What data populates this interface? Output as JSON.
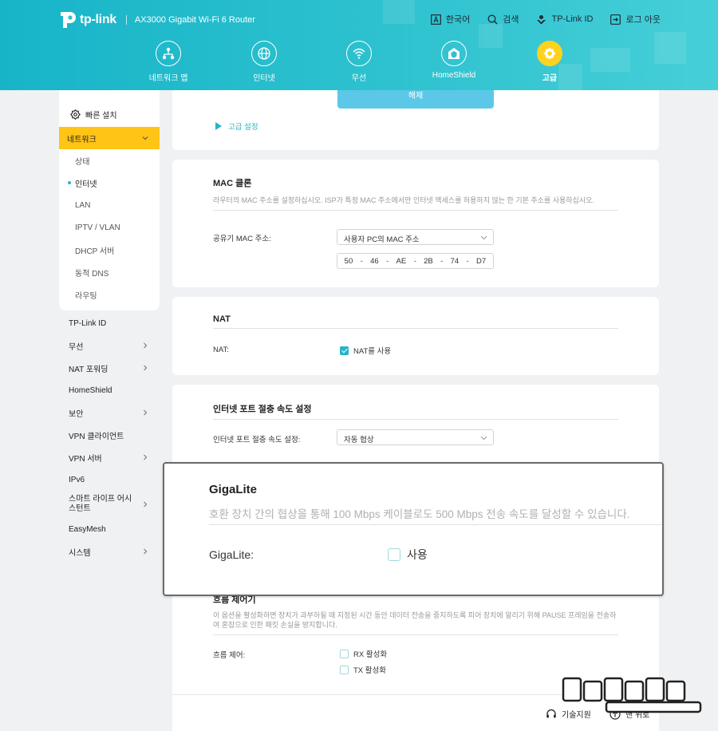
{
  "header": {
    "brand": "tp-link",
    "model": "AX3000 Gigabit Wi-Fi 6 Router",
    "links": [
      {
        "label": "한국어",
        "icon": "language-icon"
      },
      {
        "label": "검색",
        "icon": "search-icon"
      },
      {
        "label": "TP-Link ID",
        "icon": "tplink-id-icon"
      },
      {
        "label": "로그 아웃",
        "icon": "logout-icon"
      }
    ],
    "nav": [
      {
        "label": "네트워크 맵",
        "icon": "network-map-icon"
      },
      {
        "label": "인터넷",
        "icon": "globe-icon"
      },
      {
        "label": "무선",
        "icon": "wifi-icon"
      },
      {
        "label": "HomeShield",
        "icon": "homeshield-icon"
      },
      {
        "label": "고급",
        "icon": "gear-icon",
        "active": true
      }
    ]
  },
  "sidebar": {
    "quick_setup": "빠른 설치",
    "section": "네트워크",
    "sub_items": [
      "상태",
      "인터넷",
      "LAN",
      "IPTV / VLAN",
      "DHCP 서버",
      "동적 DNS",
      "라우팅"
    ],
    "active_sub": "인터넷",
    "menu": [
      {
        "label": "TP-Link ID",
        "chevron": false
      },
      {
        "label": "무선",
        "chevron": true
      },
      {
        "label": "NAT 포워딩",
        "chevron": true
      },
      {
        "label": "HomeShield",
        "chevron": false
      },
      {
        "label": "보안",
        "chevron": true
      },
      {
        "label": "VPN 클라이언트",
        "chevron": false
      },
      {
        "label": "VPN 서버",
        "chevron": true
      },
      {
        "label": "IPv6",
        "chevron": false
      },
      {
        "label": "스마트 라이프 어시스턴트",
        "chevron": true
      },
      {
        "label": "EasyMesh",
        "chevron": false
      },
      {
        "label": "시스템",
        "chevron": true
      }
    ]
  },
  "top_card": {
    "button_label": "해제",
    "advanced_link": "고급 설정"
  },
  "mac_clone": {
    "title": "MAC 클론",
    "description": "라우터의 MAC 주소를 설정하십시오. ISP가 특정 MAC 주소에서만 인터넷 액세스를 허용하지 않는 한 기본 주소를 사용하십시오.",
    "label": "공유기 MAC 주소:",
    "select_value": "사용자 PC의 MAC 주소",
    "mac": [
      "50",
      "46",
      "AE",
      "2B",
      "74",
      "D7"
    ]
  },
  "nat": {
    "title": "NAT",
    "label": "NAT:",
    "checkbox_label": "NAT를 사용",
    "checked": true
  },
  "port_speed": {
    "title": "인터넷 포트 절충 속도 설정",
    "label": "인터넷 포트 절충 속도 설정:",
    "select_value": "자동 협상"
  },
  "gigalite": {
    "title": "GigaLite",
    "description": "호환 장치 간의 협상을 통해 100 Mbps 케이블로도 500 Mbps 전송 속도를 달성할 수 있습니다.",
    "label": "GigaLite:",
    "checkbox_label": "사용",
    "checked": false
  },
  "flow_control": {
    "title": "흐름 제어기",
    "description": "이 옵션을 활성화하면 장치가 과부하될 때 지정된 시간 동안 데이터 전송을 중지하도록 피어 장치에 알리기 위해 PAUSE 프레임을 전송하여 혼잡으로 인한 패킷 손실을 방지합니다.",
    "label": "흐름 제어:",
    "rx_label": "RX 활성화",
    "tx_label": "TX 활성화"
  },
  "footer": {
    "support": "기술지원",
    "top": "맨 위로"
  },
  "colors": {
    "header": "#2ec2cf",
    "accent": "#26b5c6",
    "highlight": "#ffc415",
    "active_nav": "#ffd21f"
  }
}
